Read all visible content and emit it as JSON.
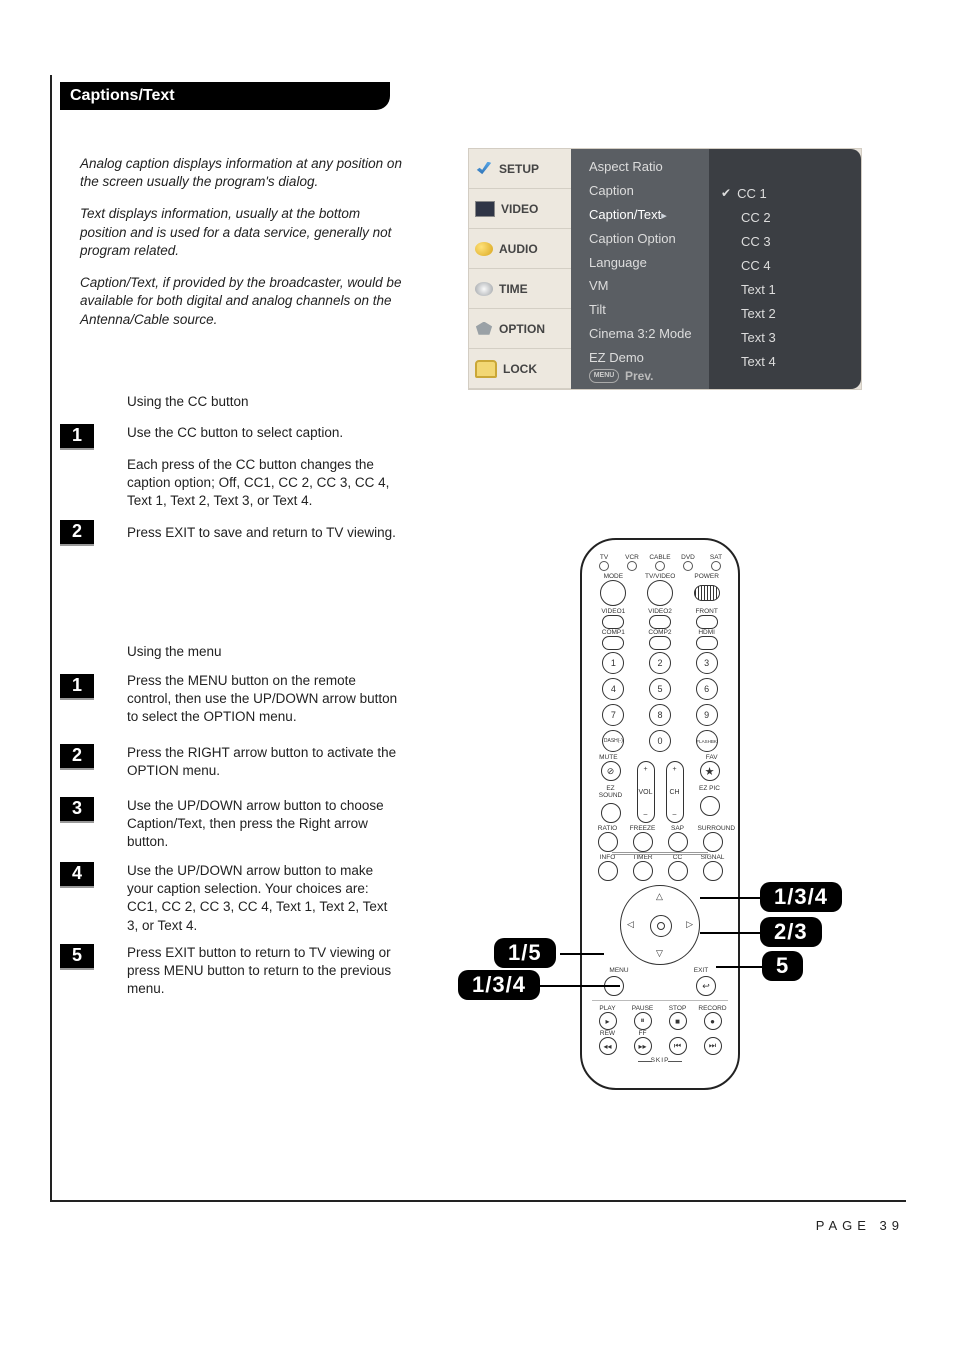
{
  "header": {
    "title": "Captions/Text"
  },
  "intro": {
    "p1": "Analog caption displays information at any position on the screen usually the program's dialog.",
    "p2": "Text displays information, usually at the bottom position and is used for a data service, generally not program related.",
    "p3": "Caption/Text, if provided by the broadcaster, would be available for both digital and analog channels on the Antenna/Cable source."
  },
  "osd": {
    "tabs": {
      "setup": "SETUP",
      "video": "VIDEO",
      "audio": "AUDIO",
      "time": "TIME",
      "option": "OPTION",
      "lock": "LOCK"
    },
    "menu": {
      "aspect_ratio": "Aspect Ratio",
      "caption": "Caption",
      "caption_text": "Caption/Text",
      "caption_option": "Caption Option",
      "language": "Language",
      "vm": "VM",
      "tilt": "Tilt",
      "cinema": "Cinema 3:2 Mode",
      "ez_demo": "EZ Demo",
      "prev_btn": "MENU",
      "prev_label": "Prev."
    },
    "options": {
      "cc1": "CC 1",
      "cc2": "CC 2",
      "cc3": "CC 3",
      "cc4": "CC 4",
      "t1": "Text 1",
      "t2": "Text 2",
      "t3": "Text 3",
      "t4": "Text 4"
    }
  },
  "cc": {
    "heading": "Using the CC button",
    "badge1": "1",
    "step1": "Use the CC button to select caption.",
    "step1b": "Each press of the CC button changes the caption option; Off, CC1, CC 2, CC 3, CC 4, Text 1, Text 2, Text 3, or Text 4.",
    "badge2": "2",
    "step2": "Press EXIT to save and return to TV viewing."
  },
  "menuSteps": {
    "heading": "Using the menu",
    "b1": "1",
    "s1": "Press the MENU button on the remote control, then use the UP/DOWN arrow button to select the OPTION menu.",
    "b2": "2",
    "s2": "Press the RIGHT arrow button to activate the OPTION menu.",
    "b3": "3",
    "s3": "Use the UP/DOWN arrow button to choose Caption/Text, then press the Right arrow button.",
    "b4": "4",
    "s4": "Use the UP/DOWN arrow button to make your caption selection. Your choices are: CC1, CC 2, CC 3, CC 4, Text 1, Text 2, Text 3, or Text 4.",
    "b5": "5",
    "s5": "Press EXIT button to return to TV viewing or press MENU button to return to the previous menu."
  },
  "remote": {
    "top": {
      "tv": "TV",
      "vcr": "VCR",
      "cable": "CABLE",
      "dvd": "DVD",
      "sat": "SAT",
      "mode": "MODE",
      "tvvideo": "TV/VIDEO",
      "power": "POWER",
      "video1": "VIDEO1",
      "video2": "VIDEO2",
      "front": "FRONT",
      "comp1": "COMP1",
      "comp2": "COMP2",
      "hdmi": "HDMI"
    },
    "nums": {
      "n1": "1",
      "n2": "2",
      "n3": "3",
      "n4": "4",
      "n5": "5",
      "n6": "6",
      "n7": "7",
      "n8": "8",
      "n9": "9",
      "n0": "0",
      "dash": "DASH(-)",
      "flashbk": "FLASHBK"
    },
    "mid": {
      "mute": "MUTE",
      "fav": "FAV",
      "ezsound": "EZ SOUND",
      "ezpic": "EZ PIC",
      "vol": "VOL",
      "ch": "CH",
      "ratio": "RATIO",
      "freeze": "FREEZE",
      "sap": "SAP",
      "surround": "SURROUND",
      "info": "INFO",
      "timer": "TIMER",
      "cc": "CC",
      "signal": "SIGNAL",
      "menu": "MENU",
      "exit": "EXIT"
    },
    "transport": {
      "play": "PLAY",
      "pause": "PAUSE",
      "stop": "STOP",
      "record": "RECORD",
      "rew": "REW",
      "ff": "FF",
      "skip": "SKIP"
    },
    "symbols": {
      "plus": "+",
      "minus": "–"
    }
  },
  "callouts": {
    "c1": "1/3/4",
    "c2": "2/3",
    "c3": "5",
    "c4": "1/5",
    "c5": "1/3/4"
  },
  "page": {
    "number": "PAGE 39"
  }
}
